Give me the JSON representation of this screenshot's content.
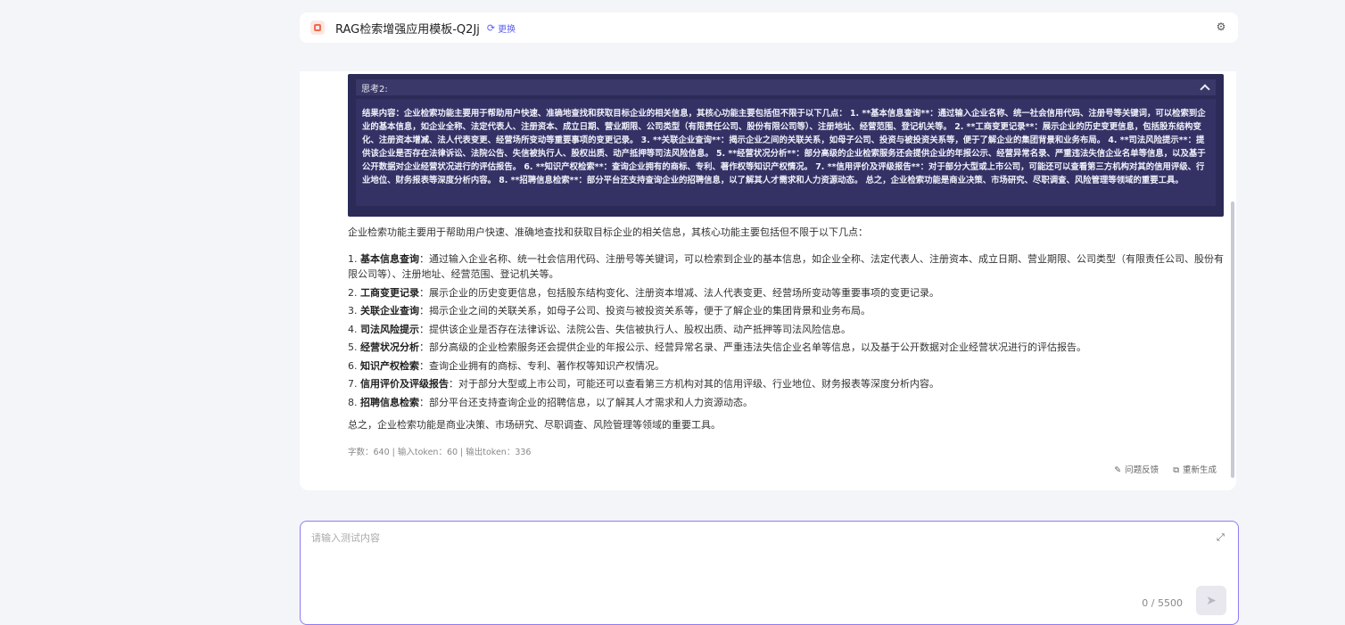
{
  "header": {
    "title": "RAG检索增强应用模板-Q2Jj",
    "switch_label": "更换"
  },
  "thinking": {
    "label": "思考2:",
    "content": "结果内容：企业检索功能主要用于帮助用户快速、准确地查找和获取目标企业的相关信息，其核心功能主要包括但不限于以下几点： 1. **基本信息查询**：通过输入企业名称、统一社会信用代码、注册号等关键词，可以检索到企业的基本信息，如企业全称、法定代表人、注册资本、成立日期、营业期限、公司类型（有限责任公司、股份有限公司等）、注册地址、经营范围、登记机关等。 2. **工商变更记录**：展示企业的历史变更信息，包括股东结构变化、注册资本增减、法人代表变更、经营场所变动等重要事项的变更记录。 3. **关联企业查询**：揭示企业之间的关联关系，如母子公司、投资与被投资关系等，便于了解企业的集团背景和业务布局。 4. **司法风险提示**：提供该企业是否存在法律诉讼、法院公告、失信被执行人、股权出质、动产抵押等司法风险信息。 5. **经营状况分析**：部分高级的企业检索服务还会提供企业的年报公示、经营异常名录、严重违法失信企业名单等信息，以及基于公开数据对企业经营状况进行的评估报告。 6. **知识产权检索**：查询企业拥有的商标、专利、著作权等知识产权情况。 7. **信用评价及评级报告**：对于部分大型或上市公司，可能还可以查看第三方机构对其的信用评级、行业地位、财务报表等深度分析内容。 8. **招聘信息检索**：部分平台还支持查询企业的招聘信息，以了解其人才需求和人力资源动态。 总之，企业检索功能是商业决策、市场研究、尽职调查、风险管理等领域的重要工具。"
  },
  "answer": {
    "intro": "企业检索功能主要用于帮助用户快速、准确地查找和获取目标企业的相关信息，其核心功能主要包括但不限于以下几点：",
    "items": [
      {
        "num": "1.",
        "title": "基本信息查询",
        "text": "通过输入企业名称、统一社会信用代码、注册号等关键词，可以检索到企业的基本信息，如企业全称、法定代表人、注册资本、成立日期、营业期限、公司类型（有限责任公司、股份有限公司等）、注册地址、经营范围、登记机关等。"
      },
      {
        "num": "2.",
        "title": "工商变更记录",
        "text": "展示企业的历史变更信息，包括股东结构变化、注册资本增减、法人代表变更、经营场所变动等重要事项的变更记录。"
      },
      {
        "num": "3.",
        "title": "关联企业查询",
        "text": "揭示企业之间的关联关系，如母子公司、投资与被投资关系等，便于了解企业的集团背景和业务布局。"
      },
      {
        "num": "4.",
        "title": "司法风险提示",
        "text": "提供该企业是否存在法律诉讼、法院公告、失信被执行人、股权出质、动产抵押等司法风险信息。"
      },
      {
        "num": "5.",
        "title": "经营状况分析",
        "text": "部分高级的企业检索服务还会提供企业的年报公示、经营异常名录、严重违法失信企业名单等信息，以及基于公开数据对企业经营状况进行的评估报告。"
      },
      {
        "num": "6.",
        "title": "知识产权检索",
        "text": "查询企业拥有的商标、专利、著作权等知识产权情况。"
      },
      {
        "num": "7.",
        "title": "信用评价及评级报告",
        "text": "对于部分大型或上市公司，可能还可以查看第三方机构对其的信用评级、行业地位、财务报表等深度分析内容。"
      },
      {
        "num": "8.",
        "title": "招聘信息检索",
        "text": "部分平台还支持查询企业的招聘信息，以了解其人才需求和人力资源动态。"
      }
    ],
    "summary": "总之，企业检索功能是商业决策、市场研究、尽职调查、风险管理等领域的重要工具。",
    "stats": "字数：640 | 输入token：60 | 输出token：336"
  },
  "actions": {
    "feedback": "问题反馈",
    "regenerate": "重新生成"
  },
  "input": {
    "placeholder": "请输入测试内容",
    "counter": "0 / 5500"
  }
}
